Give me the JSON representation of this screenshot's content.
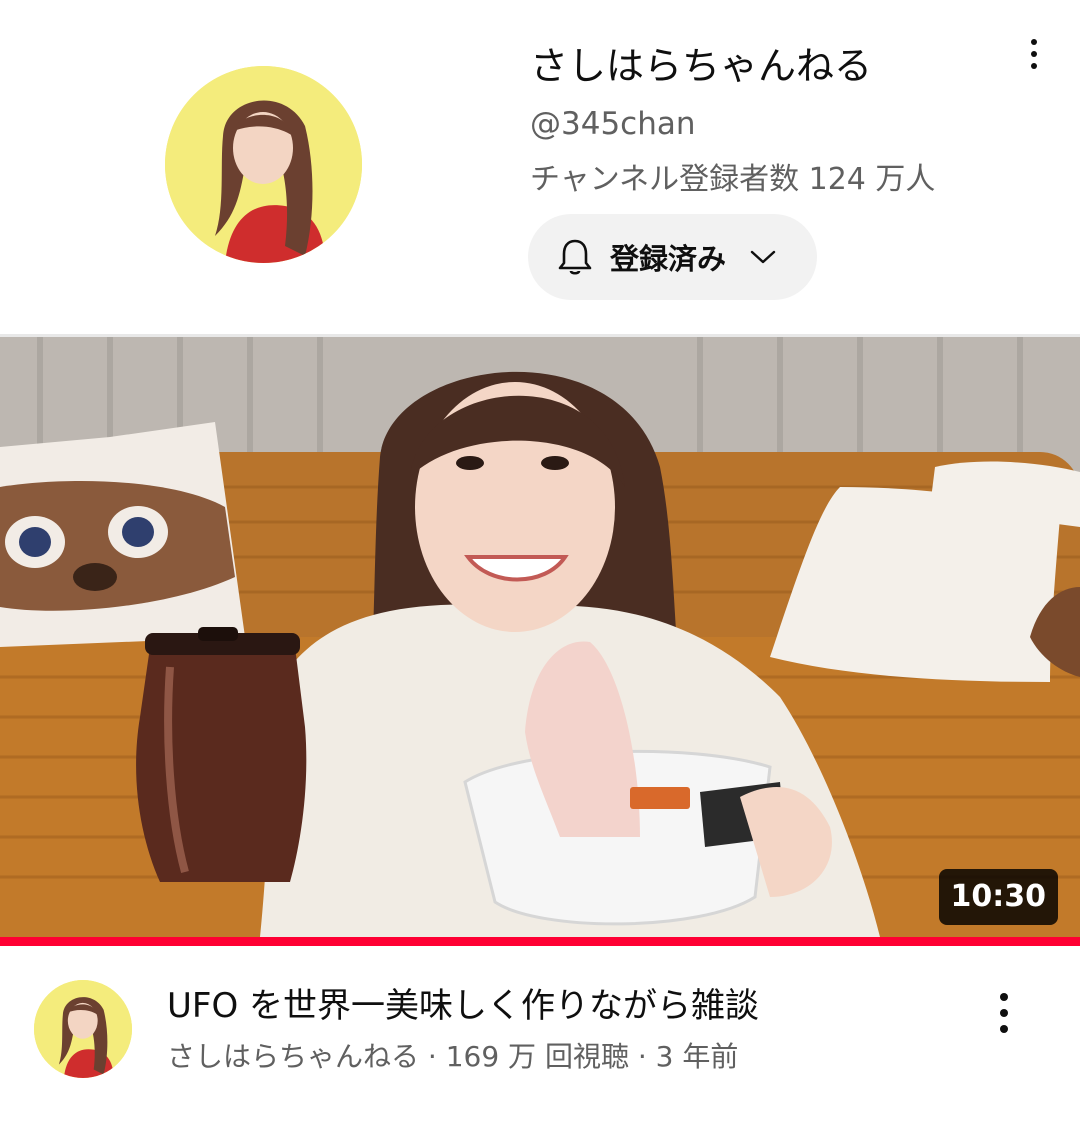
{
  "channel": {
    "name": "さしはらちゃんねる",
    "handle": "@345chan",
    "subscribers": "チャンネル登録者数 124 万人",
    "subscribe_button": {
      "label": "登録済み",
      "icon": "bell-icon",
      "dropdown_icon": "chevron-down-icon"
    },
    "menu_icon": "more-vert-icon",
    "avatar": "channel-avatar"
  },
  "video": {
    "duration": "10:30",
    "progress_fraction": 1.0,
    "title": "UFO を世界一美味しく作りながら雑談",
    "meta": "さしはらちゃんねる · 169 万 回視聴 · 3 年前",
    "menu_icon": "more-vert-icon",
    "avatar": "channel-avatar"
  },
  "colors": {
    "accent": "#ff0033",
    "subscribe_bg": "#f2f2f2",
    "secondary_text": "#606060",
    "avatar_bg": "#f4ec7c",
    "sofa": "#c27a2a"
  }
}
